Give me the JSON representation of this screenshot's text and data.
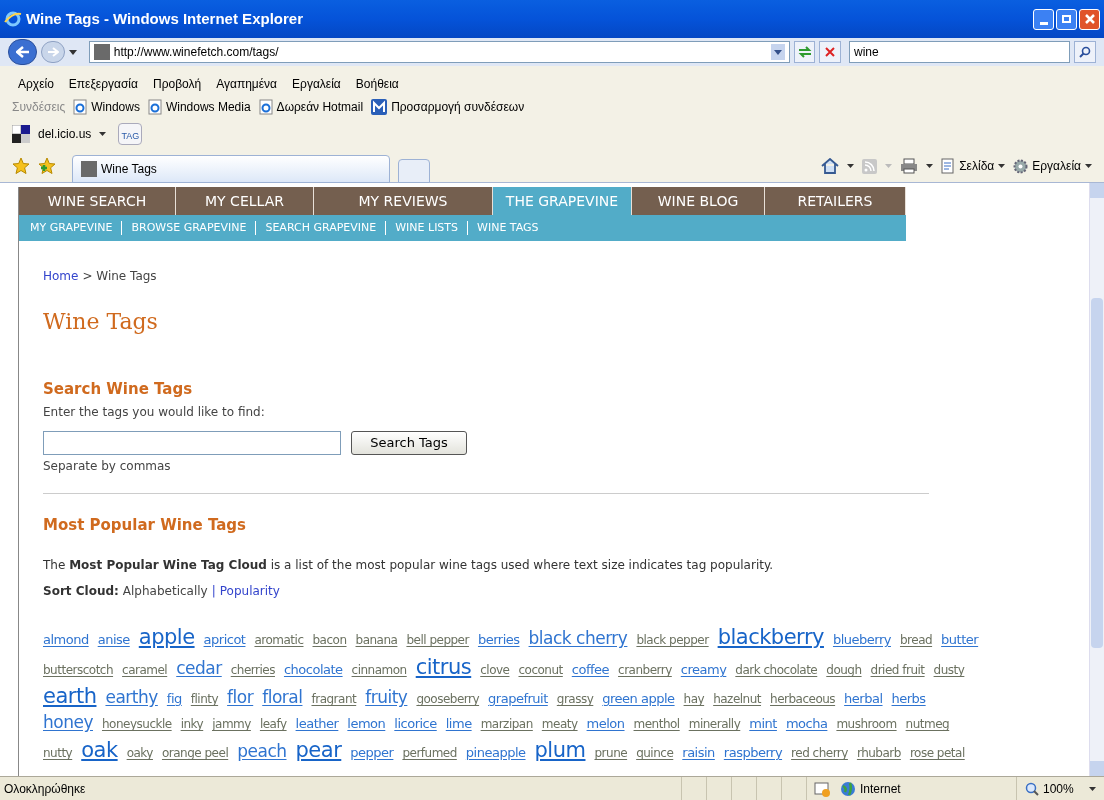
{
  "window": {
    "title": "Wine Tags - Windows Internet Explorer"
  },
  "address_bar": {
    "url": "http://www.winefetch.com/tags/"
  },
  "search_box": {
    "value": "wine"
  },
  "menu_bar": [
    "Αρχείο",
    "Επεξεργασία",
    "Προβολή",
    "Αγαπημένα",
    "Εργαλεία",
    "Βοήθεια"
  ],
  "links_bar": {
    "label": "Συνδέσεις",
    "links": [
      {
        "text": "Windows",
        "kind": "ie"
      },
      {
        "text": "Windows Media",
        "kind": "ie"
      },
      {
        "text": "Δωρεάν Hotmail",
        "kind": "ie"
      },
      {
        "text": "Προσαρμογή συνδέσεων",
        "kind": "msn"
      }
    ]
  },
  "delicious_bar": {
    "label": "del.icio.us",
    "tag_button": "TAG"
  },
  "browser_tab": {
    "title": "Wine Tags"
  },
  "command_bar": {
    "page": "Σελίδα",
    "tools": "Εργαλεία"
  },
  "main_nav": [
    {
      "label": "WINE SEARCH",
      "selected": false
    },
    {
      "label": "MY CELLAR",
      "selected": false
    },
    {
      "label": "MY REVIEWS",
      "selected": false
    },
    {
      "label": "THE GRAPEVINE",
      "selected": true
    },
    {
      "label": "WINE BLOG",
      "selected": false
    },
    {
      "label": "RETAILERS",
      "selected": false
    }
  ],
  "sub_nav": [
    "MY GRAPEVINE",
    "BROWSE GRAPEVINE",
    "SEARCH GRAPEVINE",
    "WINE LISTS",
    "WINE TAGS"
  ],
  "breadcrumb": {
    "link": "Home",
    "current": "> Wine Tags"
  },
  "page_title": "Wine Tags",
  "search_section": {
    "heading": "Search Wine Tags",
    "prompt": "Enter the tags you would like to find:",
    "button": "Search Tags",
    "hint": "Separate by commas"
  },
  "popular_section": {
    "heading": "Most Popular Wine Tags",
    "description": "The **Most Popular Wine Tag Cloud** is a list of the most popular wine tags used where text size indicates tag popularity.",
    "sort_label": "Sort Cloud:",
    "sort_separator": "|",
    "sort_options": [
      "Alphabetically",
      "Popularity"
    ]
  },
  "tag_rows": [
    [
      {
        "text": "almond",
        "kind": "medium"
      },
      {
        "text": "anise",
        "kind": "medium"
      },
      {
        "text": "apple",
        "kind": "xlarge"
      },
      {
        "text": "apricot",
        "kind": "medium"
      },
      {
        "text": "aromatic",
        "kind": "small"
      },
      {
        "text": "bacon",
        "kind": "small"
      },
      {
        "text": "banana",
        "kind": "small"
      },
      {
        "text": "bell pepper",
        "kind": "small"
      },
      {
        "text": "berries",
        "kind": "medium"
      },
      {
        "text": "black cherry",
        "kind": "large"
      },
      {
        "text": "black pepper",
        "kind": "small"
      },
      {
        "text": "blackberry",
        "kind": "xlarge"
      },
      {
        "text": "blueberry",
        "kind": "medium"
      },
      {
        "text": "bread",
        "kind": "small"
      },
      {
        "text": "butter",
        "kind": "medium"
      }
    ],
    [
      {
        "text": "butterscotch",
        "kind": "small"
      },
      {
        "text": "caramel",
        "kind": "small"
      },
      {
        "text": "cedar",
        "kind": "large"
      },
      {
        "text": "cherries",
        "kind": "small"
      },
      {
        "text": "chocolate",
        "kind": "medium"
      },
      {
        "text": "cinnamon",
        "kind": "small"
      },
      {
        "text": "citrus",
        "kind": "xlarge"
      },
      {
        "text": "clove",
        "kind": "small"
      },
      {
        "text": "coconut",
        "kind": "small"
      },
      {
        "text": "coffee",
        "kind": "medium"
      },
      {
        "text": "cranberry",
        "kind": "small"
      },
      {
        "text": "creamy",
        "kind": "medium"
      },
      {
        "text": "dark chocolate",
        "kind": "small"
      },
      {
        "text": "dough",
        "kind": "small"
      },
      {
        "text": "dried fruit",
        "kind": "small"
      },
      {
        "text": "dusty",
        "kind": "small"
      }
    ],
    [
      {
        "text": "earth",
        "kind": "xlarge"
      },
      {
        "text": "earthy",
        "kind": "large"
      },
      {
        "text": "fig",
        "kind": "medium"
      },
      {
        "text": "flinty",
        "kind": "small"
      },
      {
        "text": "flor",
        "kind": "large"
      },
      {
        "text": "floral",
        "kind": "large"
      },
      {
        "text": "fragrant",
        "kind": "small"
      },
      {
        "text": "fruity",
        "kind": "large"
      },
      {
        "text": "gooseberry",
        "kind": "small"
      },
      {
        "text": "grapefruit",
        "kind": "medium"
      },
      {
        "text": "grassy",
        "kind": "small"
      },
      {
        "text": "green apple",
        "kind": "medium"
      },
      {
        "text": "hay",
        "kind": "small"
      },
      {
        "text": "hazelnut",
        "kind": "small"
      },
      {
        "text": "herbaceous",
        "kind": "small"
      },
      {
        "text": "herbal",
        "kind": "medium"
      },
      {
        "text": "herbs",
        "kind": "medium"
      }
    ],
    [
      {
        "text": "honey",
        "kind": "large"
      },
      {
        "text": "honeysuckle",
        "kind": "small"
      },
      {
        "text": "inky",
        "kind": "small"
      },
      {
        "text": "jammy",
        "kind": "small"
      },
      {
        "text": "leafy",
        "kind": "small"
      },
      {
        "text": "leather",
        "kind": "medium"
      },
      {
        "text": "lemon",
        "kind": "medium"
      },
      {
        "text": "licorice",
        "kind": "medium"
      },
      {
        "text": "lime",
        "kind": "medium"
      },
      {
        "text": "marzipan",
        "kind": "small"
      },
      {
        "text": "meaty",
        "kind": "small"
      },
      {
        "text": "melon",
        "kind": "medium"
      },
      {
        "text": "menthol",
        "kind": "small"
      },
      {
        "text": "minerally",
        "kind": "small"
      },
      {
        "text": "mint",
        "kind": "medium"
      },
      {
        "text": "mocha",
        "kind": "medium"
      },
      {
        "text": "mushroom",
        "kind": "small"
      },
      {
        "text": "nutmeg",
        "kind": "small"
      }
    ],
    [
      {
        "text": "nutty",
        "kind": "small"
      },
      {
        "text": "oak",
        "kind": "xlarge"
      },
      {
        "text": "oaky",
        "kind": "small"
      },
      {
        "text": "orange peel",
        "kind": "small"
      },
      {
        "text": "peach",
        "kind": "large"
      },
      {
        "text": "pear",
        "kind": "xlarge"
      },
      {
        "text": "pepper",
        "kind": "medium"
      },
      {
        "text": "perfumed",
        "kind": "small"
      },
      {
        "text": "pineapple",
        "kind": "medium"
      },
      {
        "text": "plum",
        "kind": "xlarge"
      },
      {
        "text": "prune",
        "kind": "small"
      },
      {
        "text": "quince",
        "kind": "small"
      },
      {
        "text": "raisin",
        "kind": "medium"
      },
      {
        "text": "raspberry",
        "kind": "medium"
      },
      {
        "text": "red cherry",
        "kind": "small"
      },
      {
        "text": "rhubarb",
        "kind": "small"
      },
      {
        "text": "rose petal",
        "kind": "small"
      }
    ]
  ],
  "status_bar": {
    "text": "Ολοκληρώθηκε",
    "zone": "Internet",
    "zoom": "100%"
  }
}
